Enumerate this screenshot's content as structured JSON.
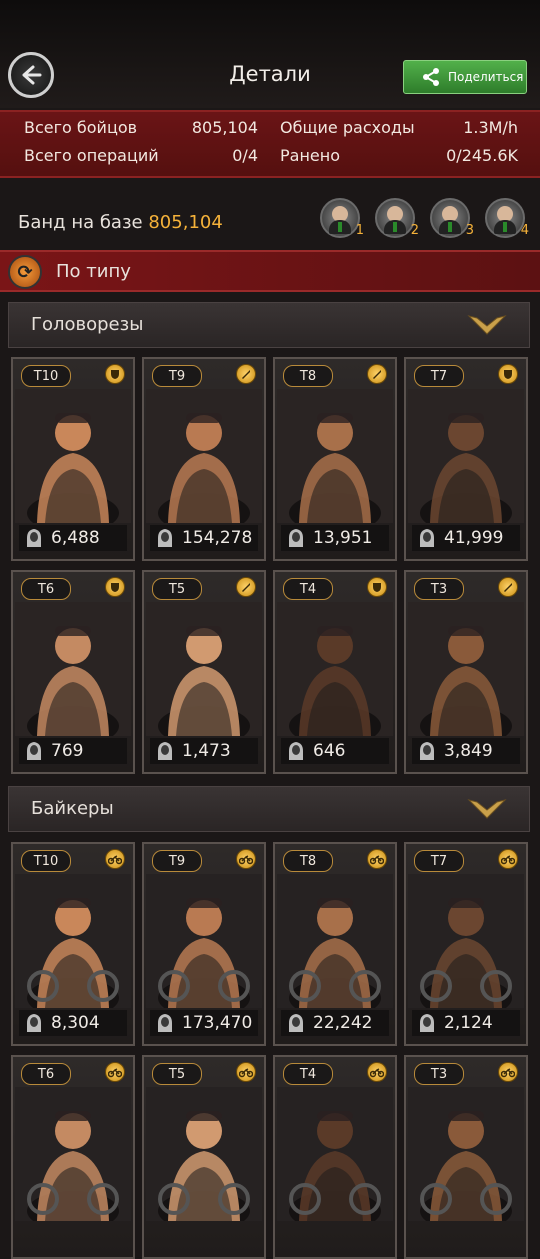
{
  "header": {
    "title": "Детали",
    "share_label": "Поделиться"
  },
  "stats": {
    "total_fighters_label": "Всего бойцов",
    "total_fighters_value": "805,104",
    "total_ops_label": "Всего операций",
    "total_ops_value": "0/4",
    "expenses_label": "Общие расходы",
    "expenses_value": "1.3M/h",
    "wounded_label": "Ранено",
    "wounded_value": "0/245.6K"
  },
  "base": {
    "label": "Банд на базе",
    "value": "805,104",
    "squads": [
      "1",
      "2",
      "3",
      "4"
    ]
  },
  "sort": {
    "label": "По типу"
  },
  "sections": [
    {
      "title": "Головорезы",
      "units": [
        {
          "tier": "T10",
          "count": "6,488",
          "type": "shield-icon"
        },
        {
          "tier": "T9",
          "count": "154,278",
          "type": "knife-icon"
        },
        {
          "tier": "T8",
          "count": "13,951",
          "type": "knife-icon"
        },
        {
          "tier": "T7",
          "count": "41,999",
          "type": "shield-icon"
        },
        {
          "tier": "T6",
          "count": "769",
          "type": "shield-icon"
        },
        {
          "tier": "T5",
          "count": "1,473",
          "type": "knife-icon"
        },
        {
          "tier": "T4",
          "count": "646",
          "type": "shield-icon"
        },
        {
          "tier": "T3",
          "count": "3,849",
          "type": "knife-icon"
        }
      ]
    },
    {
      "title": "Байкеры",
      "units": [
        {
          "tier": "T10",
          "count": "8,304",
          "type": "motorbike-icon"
        },
        {
          "tier": "T9",
          "count": "173,470",
          "type": "motorbike-icon"
        },
        {
          "tier": "T8",
          "count": "22,242",
          "type": "motorbike-icon"
        },
        {
          "tier": "T7",
          "count": "2,124",
          "type": "motorbike-icon"
        },
        {
          "tier": "T6",
          "count": "",
          "type": "motorbike-icon"
        },
        {
          "tier": "T5",
          "count": "",
          "type": "motorbike-icon"
        },
        {
          "tier": "T4",
          "count": "",
          "type": "motorbike-icon"
        },
        {
          "tier": "T3",
          "count": "",
          "type": "motorbike-icon"
        }
      ]
    }
  ],
  "colors": {
    "accent_orange": "#f5b23a",
    "stats_red": "#6a1416",
    "share_green": "#3f9a3a"
  }
}
